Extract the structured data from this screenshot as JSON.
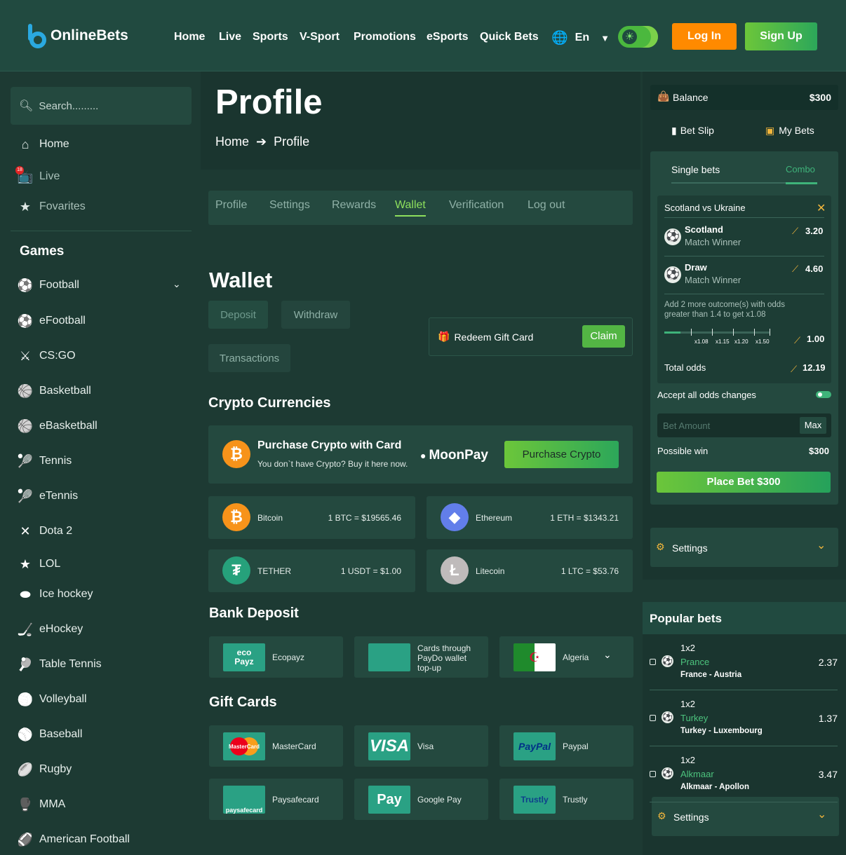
{
  "header": {
    "logo_text": "OnlineBets",
    "nav": [
      "Home",
      "Live",
      "Sports",
      "V-Sport",
      "Promotions",
      "eSports",
      "Quick Bets"
    ],
    "language": "En",
    "login": "Log In",
    "signup": "Sign Up"
  },
  "sidebar": {
    "search_placeholder": "Search.........",
    "top_items": [
      {
        "label": "Home",
        "icon": "home-icon"
      },
      {
        "label": "Live",
        "icon": "live-icon",
        "badge": "18"
      },
      {
        "label": "Fovarites",
        "icon": "star-icon"
      }
    ],
    "games_heading": "Games",
    "games": [
      {
        "label": "Football",
        "icon": "football-icon"
      },
      {
        "label": "eFootball",
        "icon": "efootball-icon"
      },
      {
        "label": "CS:GO",
        "icon": "csgo-icon"
      },
      {
        "label": "Basketball",
        "icon": "basketball-icon"
      },
      {
        "label": "eBasketball",
        "icon": "ebasketball-icon"
      },
      {
        "label": "Tennis",
        "icon": "tennis-icon"
      },
      {
        "label": "eTennis",
        "icon": "etennis-icon"
      },
      {
        "label": "Dota 2",
        "icon": "dota-icon"
      },
      {
        "label": "LOL",
        "icon": "lol-icon"
      },
      {
        "label": "Ice hockey",
        "icon": "ice-hockey-icon"
      },
      {
        "label": "eHockey",
        "icon": "ehockey-icon"
      },
      {
        "label": "Table Tennis",
        "icon": "table-tennis-icon"
      },
      {
        "label": "Volleyball",
        "icon": "volleyball-icon"
      },
      {
        "label": "Baseball",
        "icon": "baseball-icon"
      },
      {
        "label": "Rugby",
        "icon": "rugby-icon"
      },
      {
        "label": "MMA",
        "icon": "mma-icon"
      },
      {
        "label": "American Football",
        "icon": "american-football-icon"
      }
    ]
  },
  "page": {
    "title": "Profile",
    "breadcrumb": [
      "Home",
      "Profile"
    ],
    "tabs": [
      "Profile",
      "Settings",
      "Rewards",
      "Wallet",
      "Verification",
      "Log out"
    ],
    "active_tab": "Wallet"
  },
  "wallet": {
    "heading": "Wallet",
    "buttons": [
      "Deposit",
      "Withdraw",
      "Transactions"
    ],
    "redeem_label": "Redeem Gift Card",
    "claim": "Claim",
    "crypto_heading": "Crypto Currencies",
    "purchase_title": "Purchase Crypto with Card",
    "purchase_sub": "You don`t have Crypto? Buy it here now.",
    "moonpay": "MoonPay",
    "purchase_btn": "Purchase Crypto",
    "coins": [
      {
        "name": "Bitcoin",
        "rate": "1 BTC = $19565.46",
        "symbol": "₿",
        "color": "#f7931a"
      },
      {
        "name": "Ethereum",
        "rate": "1 ETH = $1343.21",
        "symbol": "◆",
        "color": "#627eea"
      },
      {
        "name": "TETHER",
        "rate": "1 USDT = $1.00",
        "symbol": "₮",
        "color": "#26a17b"
      },
      {
        "name": "Litecoin",
        "rate": "1 LTC = $53.76",
        "symbol": "Ł",
        "color": "#bfbbbb"
      }
    ],
    "bank_heading": "Bank Deposit",
    "bank": [
      {
        "name": "Ecopayz",
        "logo": "eco Payz"
      },
      {
        "name": "Cards through PayDo wallet top-up",
        "logo": ""
      },
      {
        "name": "Algeria",
        "logo": ""
      }
    ],
    "gift_heading": "Gift Cards",
    "gifts": [
      {
        "name": "MasterCard",
        "logo": "MasterCard"
      },
      {
        "name": "Visa",
        "logo": "VISA"
      },
      {
        "name": "Paypal",
        "logo": "PayPal"
      },
      {
        "name": "Paysafecard",
        "logo": "paysafecard"
      },
      {
        "name": "Google Pay",
        "logo": "Pay"
      },
      {
        "name": "Trustly",
        "logo": "Trustly"
      }
    ]
  },
  "betslip": {
    "balance_label": "Balance",
    "balance_value": "$300",
    "bet_slip": "Bet Slip",
    "my_bets": "My Bets",
    "single": "Single bets",
    "combo": "Combo",
    "match": "Scotland vs Ukraine",
    "selections": [
      {
        "team": "Scotland",
        "market": "Match Winner",
        "odds": "3.20"
      },
      {
        "team": "Draw",
        "market": "Match Winner",
        "odds": "4.60"
      }
    ],
    "hint": "Add 2 more outcome(s) with odds greater than 1.4 to get x1.08",
    "progress_fraction": 0.15,
    "scale": [
      "x1.08",
      "x1.15",
      "x1.20",
      "x1.50"
    ],
    "boost_odds": "1.00",
    "total_label": "Total odds",
    "total_value": "12.19",
    "accept_label": "Accept all odds changes",
    "bet_placeholder": "Bet Amount",
    "max": "Max",
    "possible_label": "Possible win",
    "possible_value": "$300",
    "place": "Place Bet $300",
    "settings": "Settings"
  },
  "popular": {
    "heading": "Popular bets",
    "rows": [
      {
        "market": "1x2",
        "pick": "Prance",
        "match": "France - Austria",
        "odds": "2.37"
      },
      {
        "market": "1x2",
        "pick": "Turkey",
        "match": "Turkey - Luxembourg",
        "odds": "1.37"
      },
      {
        "market": "1x2",
        "pick": "Alkmaar",
        "match": "Alkmaar - Apollon",
        "odds": "3.47"
      }
    ],
    "settings": "Settings"
  },
  "colors": {
    "accent": "#8ee05d",
    "bg": "#1d3a33",
    "card": "#24493f",
    "orange": "#ff8a00"
  }
}
